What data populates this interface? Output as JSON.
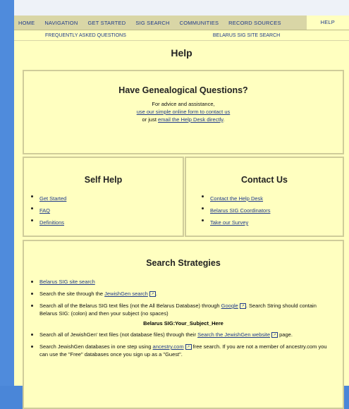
{
  "nav": {
    "items": [
      "HOME",
      "NAVIGATION",
      "GET STARTED",
      "SIG SEARCH",
      "COMMUNITIES",
      "RECORD SOURCES"
    ],
    "active": "HELP"
  },
  "subnav": {
    "faq": "FREQUENTLY ASKED QUESTIONS",
    "site_search": "BELARUS SIG SITE SEARCH"
  },
  "page_title": "Help",
  "genealogical": {
    "title": "Have Genealogical Questions?",
    "line1": "For advice and assistance,",
    "link1": "use our simple online form to contact us",
    "line3_prefix": "or just ",
    "link2": "email the Help Desk directly",
    "line3_suffix": "."
  },
  "self_help": {
    "title": "Self Help",
    "items": [
      "Get Started",
      "FAQ",
      "Definitions"
    ]
  },
  "contact": {
    "title": "Contact Us",
    "items": [
      "Contact the Help Desk",
      "Belarus SIG Coordinators",
      "Take our Survey"
    ]
  },
  "search": {
    "title": "Search Strategies",
    "item1_link": "Belarus SIG site search",
    "item2_prefix": "Search the site through the ",
    "item2_link": "JewishGen search",
    "item2_suffix": ".",
    "item3_prefix": "Search all of the Belarus SIG text files (not the All Belarus Database) through ",
    "item3_link": "Google",
    "item3_suffix": ". Search String should contain Belarus SIG: (colon) and then your subject (no spaces)",
    "search_string": "Belarus SIG:Your_Subject_Here",
    "item4_prefix": "Search all of JewishGen' text files (not database files) through their ",
    "item4_link": "Search the JewishGen website",
    "item4_suffix": " page.",
    "item5_prefix": "Search JewishGen databases in one step using ",
    "item5_link": "ancestry.com",
    "item5_suffix": " free search. If you are not a member of ancestry.com you can use the \"Free\" databases once you sign up as a \"Guest\"."
  }
}
